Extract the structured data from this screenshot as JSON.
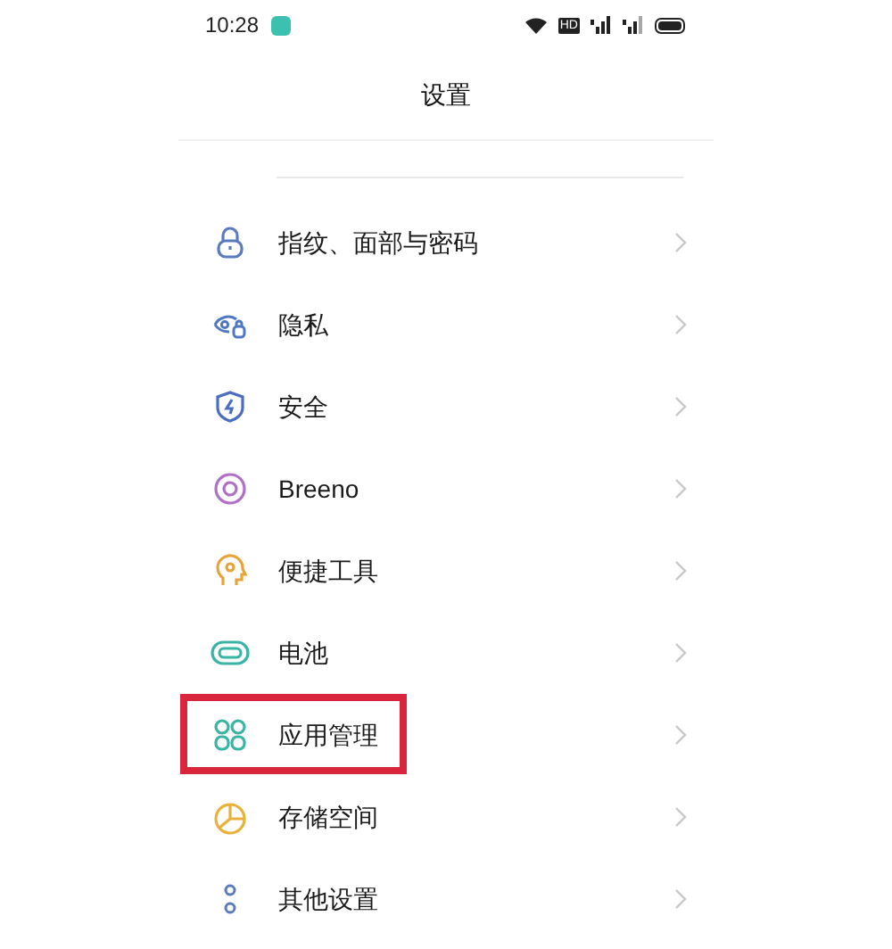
{
  "status_bar": {
    "time": "10:28",
    "network": "HD"
  },
  "title": "设置",
  "items": [
    {
      "label": "指纹、面部与密码",
      "highlighted": false
    },
    {
      "label": "隐私",
      "highlighted": false
    },
    {
      "label": "安全",
      "highlighted": false
    },
    {
      "label": "Breeno",
      "highlighted": false
    },
    {
      "label": "便捷工具",
      "highlighted": false
    },
    {
      "label": "电池",
      "highlighted": false
    },
    {
      "label": "应用管理",
      "highlighted": true
    },
    {
      "label": "存储空间",
      "highlighted": false
    },
    {
      "label": "其他设置",
      "highlighted": false
    }
  ]
}
